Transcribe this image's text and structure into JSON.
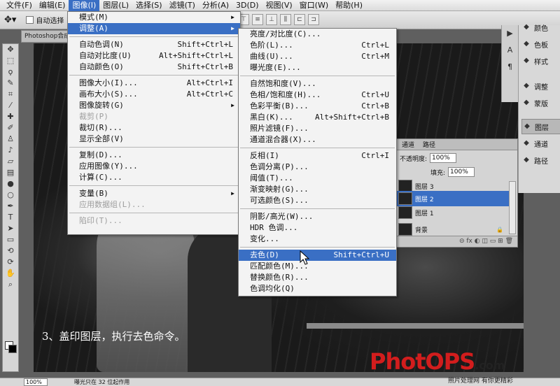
{
  "menubar": {
    "items": [
      "文件(F)",
      "编辑(E)",
      "图像(I)",
      "图层(L)",
      "选择(S)",
      "滤镜(T)",
      "分析(A)",
      "3D(D)",
      "视图(V)",
      "窗口(W)",
      "帮助(H)"
    ],
    "active_index": 2
  },
  "options_bar": {
    "tool_icon": "move-tool-icon",
    "auto_select_label": "自动选择"
  },
  "document_tab": "Photoshop合成",
  "image_menu": {
    "items": [
      {
        "label": "模式(M)",
        "arrow": true
      },
      {
        "label": "调整(A)",
        "arrow": true,
        "highlighted": true
      },
      {
        "label": "自动色调(N)",
        "shortcut": "Shift+Ctrl+L"
      },
      {
        "label": "自动对比度(U)",
        "shortcut": "Alt+Shift+Ctrl+L"
      },
      {
        "label": "自动颜色(O)",
        "shortcut": "Shift+Ctrl+B"
      },
      {
        "label": "图像大小(I)...",
        "shortcut": "Alt+Ctrl+I"
      },
      {
        "label": "画布大小(S)...",
        "shortcut": "Alt+Ctrl+C"
      },
      {
        "label": "图像旋转(G)",
        "arrow": true
      },
      {
        "label": "裁剪(P)",
        "disabled": true
      },
      {
        "label": "裁切(R)..."
      },
      {
        "label": "显示全部(V)"
      },
      {
        "label": "复制(D)..."
      },
      {
        "label": "应用图像(Y)..."
      },
      {
        "label": "计算(C)..."
      },
      {
        "label": "变量(B)",
        "arrow": true
      },
      {
        "label": "应用数据组(L)...",
        "disabled": true
      },
      {
        "label": "陷印(T)...",
        "disabled": true
      }
    ]
  },
  "adjust_menu": {
    "items": [
      {
        "label": "亮度/对比度(C)..."
      },
      {
        "label": "色阶(L)...",
        "shortcut": "Ctrl+L"
      },
      {
        "label": "曲线(U)...",
        "shortcut": "Ctrl+M"
      },
      {
        "label": "曝光度(E)..."
      },
      {
        "label": "自然饱和度(V)..."
      },
      {
        "label": "色相/饱和度(H)...",
        "shortcut": "Ctrl+U"
      },
      {
        "label": "色彩平衡(B)...",
        "shortcut": "Ctrl+B"
      },
      {
        "label": "黑白(K)...",
        "shortcut": "Alt+Shift+Ctrl+B"
      },
      {
        "label": "照片滤镜(F)..."
      },
      {
        "label": "通道混合器(X)..."
      },
      {
        "label": "反相(I)",
        "shortcut": "Ctrl+I"
      },
      {
        "label": "色调分离(P)..."
      },
      {
        "label": "阈值(T)..."
      },
      {
        "label": "渐变映射(G)..."
      },
      {
        "label": "可选颜色(S)..."
      },
      {
        "label": "阴影/高光(W)..."
      },
      {
        "label": "HDR 色调..."
      },
      {
        "label": "变化..."
      },
      {
        "label": "去色(D)",
        "shortcut": "Shift+Ctrl+U",
        "highlighted": true
      },
      {
        "label": "匹配颜色(M)..."
      },
      {
        "label": "替换颜色(R)..."
      },
      {
        "label": "色调均化(Q)"
      }
    ]
  },
  "right_panel": {
    "items": [
      {
        "label": "颜色",
        "icon": "color-icon"
      },
      {
        "label": "色板",
        "icon": "swatches-icon"
      },
      {
        "label": "样式",
        "icon": "styles-icon"
      },
      {
        "label": "调整",
        "icon": "adjust-icon"
      },
      {
        "label": "蒙版",
        "icon": "mask-icon"
      },
      {
        "label": "图层",
        "icon": "layers-icon",
        "active": true
      },
      {
        "label": "通道",
        "icon": "channels-icon"
      },
      {
        "label": "路径",
        "icon": "paths-icon"
      }
    ]
  },
  "layers_panel": {
    "tabs": [
      "通道",
      "路径"
    ],
    "opacity_label": "不透明度:",
    "opacity_value": "100%",
    "fill_label": "填充:",
    "fill_value": "100%",
    "layers": [
      {
        "name": "图层 3"
      },
      {
        "name": "图层 2",
        "selected": true
      },
      {
        "name": "图层 1"
      },
      {
        "name": "背景",
        "locked": true
      }
    ]
  },
  "caption": "3、盖印图层，执行去色命令。",
  "status": {
    "zoom": "100%",
    "info": "曝光只在 32 位起作用"
  },
  "watermark": {
    "logo_main": "PhotOPS",
    "logo_suffix": ".com",
    "slogan": "照片处理网 有你更精彩"
  }
}
